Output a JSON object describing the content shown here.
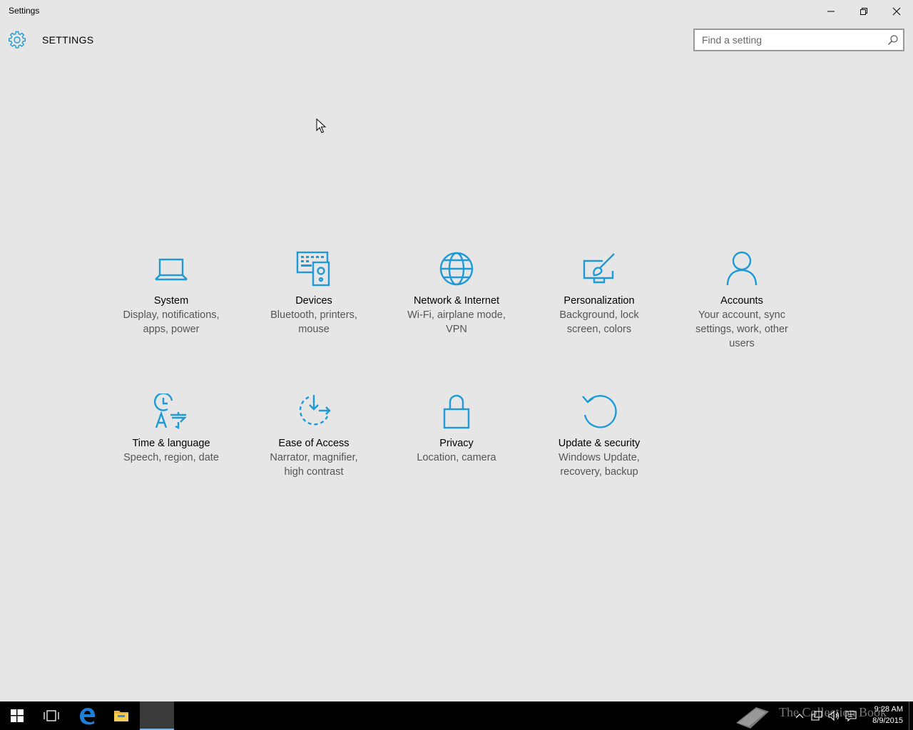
{
  "window": {
    "title": "Settings"
  },
  "header": {
    "heading": "SETTINGS"
  },
  "search": {
    "placeholder": "Find a setting"
  },
  "tiles": [
    {
      "name": "System",
      "desc": "Display, notifications, apps, power",
      "icon": "laptop-icon"
    },
    {
      "name": "Devices",
      "desc": "Bluetooth, printers, mouse",
      "icon": "devices-icon"
    },
    {
      "name": "Network & Internet",
      "desc": "Wi-Fi, airplane mode, VPN",
      "icon": "globe-icon"
    },
    {
      "name": "Personalization",
      "desc": "Background, lock screen, colors",
      "icon": "paintbrush-icon"
    },
    {
      "name": "Accounts",
      "desc": "Your account, sync settings, work, other users",
      "icon": "person-icon"
    },
    {
      "name": "Time & language",
      "desc": "Speech, region, date",
      "icon": "time-language-icon"
    },
    {
      "name": "Ease of Access",
      "desc": "Narrator, magnifier, high contrast",
      "icon": "ease-of-access-icon"
    },
    {
      "name": "Privacy",
      "desc": "Location, camera",
      "icon": "lock-icon"
    },
    {
      "name": "Update & security",
      "desc": "Windows Update, recovery, backup",
      "icon": "refresh-icon"
    }
  ],
  "taskbar": {
    "watermark": "The Collection Book",
    "clock": {
      "time": "9:28 AM",
      "date": "8/9/2015"
    }
  },
  "colors": {
    "accent": "#1e9ad6",
    "background": "#e6e6e6",
    "taskbar": "#000000"
  }
}
